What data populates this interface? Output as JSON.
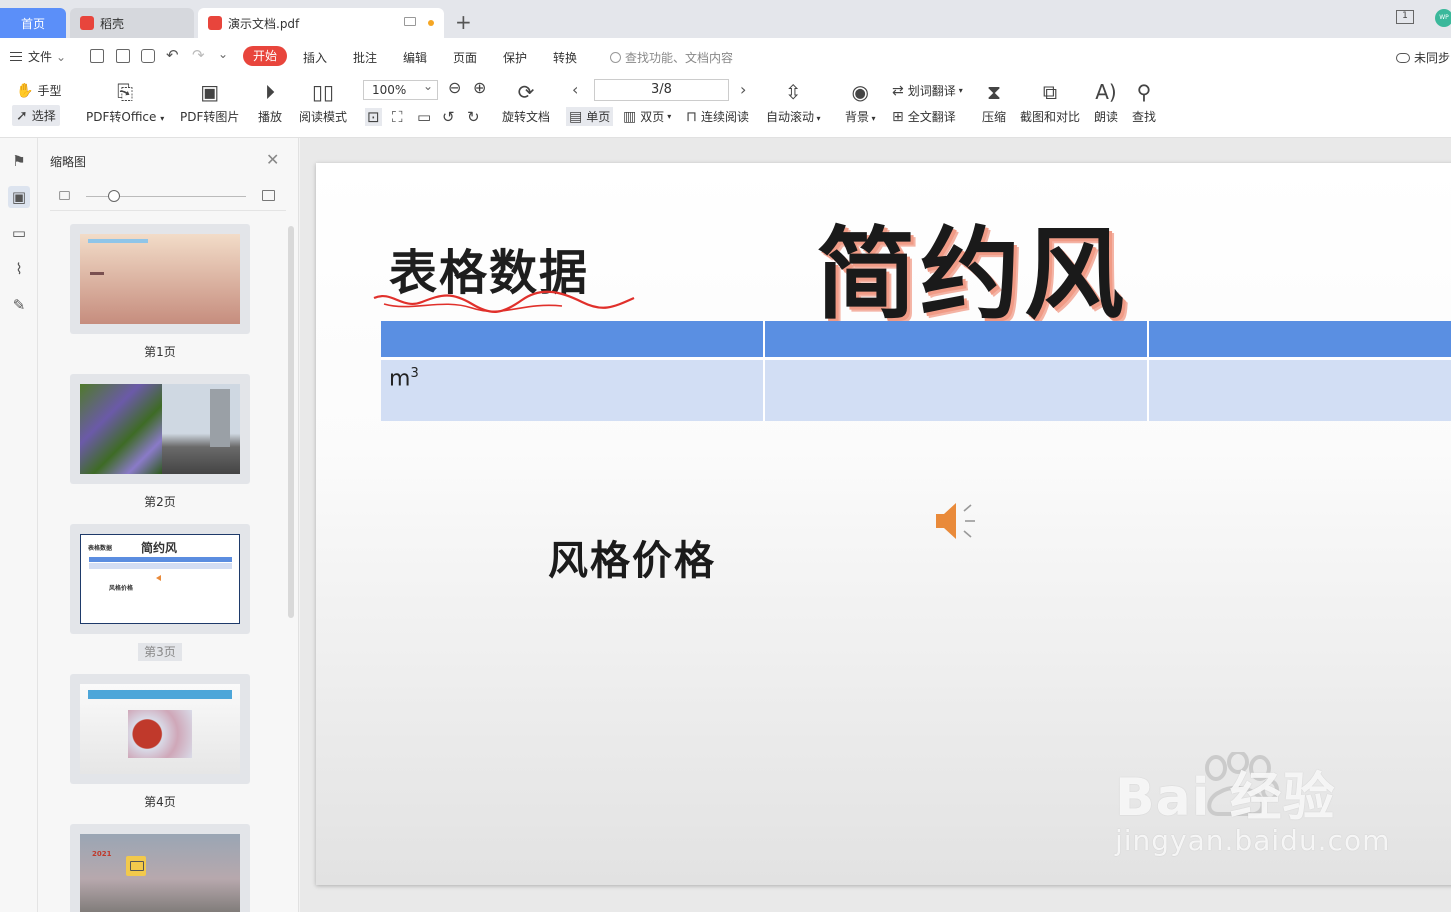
{
  "tabs": {
    "home": "首页",
    "daoke": "稻壳",
    "doc": "演示文档.pdf",
    "avatar": "WP"
  },
  "menu": {
    "file": "文件",
    "start": "开始",
    "items": [
      "插入",
      "批注",
      "编辑",
      "页面",
      "保护",
      "转换"
    ],
    "search_placeholder": "查找功能、文档内容",
    "sync": "未同步"
  },
  "ribbon": {
    "hand": "手型",
    "select": "选择",
    "pdf_to_office": "PDF转Office",
    "pdf_to_image": "PDF转图片",
    "play": "播放",
    "read_mode": "阅读模式",
    "zoom": "100%",
    "rotate": "旋转文档",
    "page_indicator": "3/8",
    "single_page": "单页",
    "double_page": "双页",
    "continuous": "连续阅读",
    "auto_scroll": "自动滚动",
    "background": "背景",
    "word_translate": "划词翻译",
    "full_translate": "全文翻译",
    "compress": "压缩",
    "screenshot_compare": "截图和对比",
    "read_aloud": "朗读",
    "find": "查找"
  },
  "thumbnails": {
    "title": "缩略图",
    "pages": [
      {
        "label": "第1页"
      },
      {
        "label": "第2页"
      },
      {
        "label": "第3页",
        "current": true
      },
      {
        "label": "第4页"
      }
    ],
    "p3_subtitle": "表格数据",
    "p3_title": "简约风",
    "p3_sub2": "风格价格",
    "p5_year": "2021"
  },
  "slide": {
    "subtitle": "表格数据",
    "title": "简约风",
    "table_cell": "m",
    "table_cell_sup": "3",
    "subtitle2": "风格价格"
  },
  "watermark": {
    "line1": "Bai   经验",
    "line2": "jingyan.baidu.com"
  },
  "colors": {
    "accent_red": "#e8453c",
    "tab_blue": "#5b8ff9",
    "table_header": "#5a8fe2",
    "table_row": "#d2def4",
    "speaker": "#e98a3a"
  }
}
